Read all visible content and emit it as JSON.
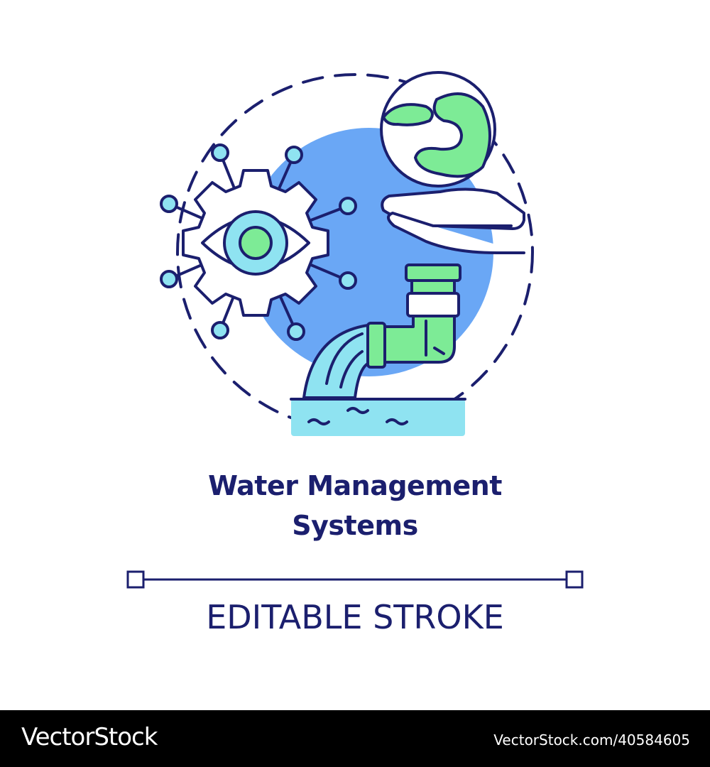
{
  "title": {
    "line1": "Water Management",
    "line2": "Systems"
  },
  "subtitle": "EDITABLE STROKE",
  "footer": {
    "logo_text": "VectorStock",
    "image_id": "VectorStock.com/40584605"
  },
  "colors": {
    "outline": "#1b1f6e",
    "blue_fill": "#6aa7f5",
    "green_fill": "#7deb96",
    "cyan_fill": "#8fe3f1",
    "background": "#ffffff",
    "footer_bg": "#000000"
  },
  "icons": [
    "gear-eye-icon",
    "globe-icon",
    "hand-icon",
    "pipe-icon",
    "water-icon"
  ]
}
